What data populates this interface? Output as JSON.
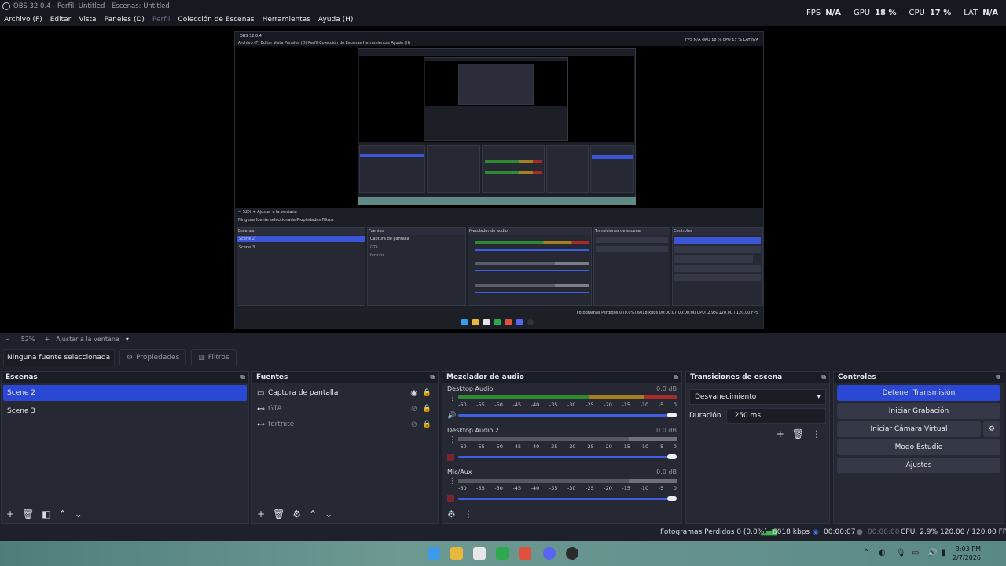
{
  "window": {
    "title": "OBS 32.0.4 - Perfil: Untitled - Escenas: Untitled"
  },
  "menu": [
    "Archivo (F)",
    "Editar",
    "Vista",
    "Paneles (D)",
    "Perfil",
    "Colección de Escenas",
    "Herramientas",
    "Ayuda (H)"
  ],
  "stats": {
    "fps_label": "FPS",
    "fps": "N/A",
    "gpu_label": "GPU",
    "gpu": "18 %",
    "cpu_label": "CPU",
    "cpu": "17 %",
    "lat_label": "LAT",
    "lat": "N/A"
  },
  "zoom": {
    "minus": "−",
    "value": "52%",
    "plus": "+",
    "fit": "Ajustar a la ventana"
  },
  "properties_bar": {
    "selection": "Ninguna fuente seleccionada",
    "properties": "Propiedades",
    "filters": "Filtros"
  },
  "scenes": {
    "title": "Escenas",
    "items": [
      "Scene 2",
      "Scene 3"
    ],
    "active_index": 0
  },
  "sources": {
    "title": "Fuentes",
    "items": [
      {
        "name": "Captura de pantalla",
        "visible": true
      },
      {
        "name": "GTA",
        "visible": false
      },
      {
        "name": "fortnite",
        "visible": false
      }
    ]
  },
  "mixer": {
    "title": "Mezclador de audio",
    "channels": [
      {
        "name": "Desktop Audio",
        "db": "0.0 dB",
        "muted": false,
        "active": true
      },
      {
        "name": "Desktop Audio 2",
        "db": "0.0 dB",
        "muted": true,
        "active": false
      },
      {
        "name": "Mic/Aux",
        "db": "0.0 dB",
        "muted": true,
        "active": false
      }
    ],
    "ticks": [
      "-60",
      "-55",
      "-50",
      "-45",
      "-40",
      "-35",
      "-30",
      "-25",
      "-20",
      "-15",
      "-10",
      "-5",
      "0"
    ]
  },
  "transitions": {
    "title": "Transiciones de escena",
    "selected": "Desvanecimiento",
    "duration_label": "Duración",
    "duration": "250 ms"
  },
  "controls": {
    "title": "Controles",
    "stop_stream": "Detener Transmisión",
    "start_record": "Iniciar Grabación",
    "virtual_cam": "Iniciar Cámara Virtual",
    "studio": "Modo Estudio",
    "settings": "Ajustes"
  },
  "status": {
    "dropped": "Fotogramas Perdidos 0 (0.0%)",
    "kbps": "6018 kbps",
    "stream_time": "00:00:07",
    "rec_time": "00:00:00",
    "cpu": "CPU: 2.9%",
    "fps": "120.00 / 120.00 FPS"
  },
  "taskbar": {
    "time": "3:03 PM",
    "date": "2/7/2026"
  },
  "colors": {
    "accent": "#2a48d4",
    "panel": "#262833",
    "background": "#1f212a"
  }
}
